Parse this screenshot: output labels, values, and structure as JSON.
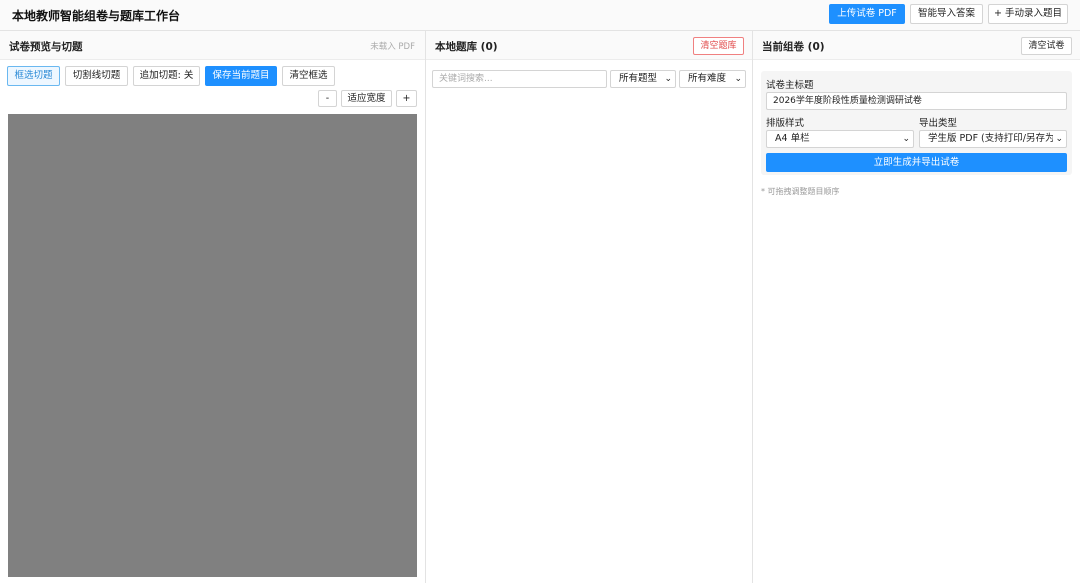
{
  "app": {
    "title": "本地教师智能组卷与题库工作台"
  },
  "header": {
    "upload_pdf": "上传试卷 PDF",
    "smart_import": "智能导入答案",
    "manual_add": "+ 手动录入题目"
  },
  "preview": {
    "title": "试卷预览与切题",
    "status": "未载入 PDF",
    "tools": {
      "box_select": "框选切题",
      "cut_line": "切割线切题",
      "append_toggle": "追加切题: 关",
      "save_question": "保存当前题目",
      "clear_selection": "清空框选"
    },
    "zoom": {
      "zoom_out": "-",
      "fit_width": "适应宽度",
      "zoom_in": "+"
    }
  },
  "bank": {
    "title": "本地题库 (0)",
    "clear": "清空题库",
    "search_placeholder": "关键词搜索...",
    "type_filter": "所有题型",
    "difficulty_filter": "所有难度"
  },
  "paper": {
    "title": "当前组卷 (0)",
    "clear": "清空试卷",
    "main_title_label": "试卷主标题",
    "main_title_value": "2026学年度阶段性质量检测调研试卷",
    "layout_label": "排版样式",
    "layout_value": "A4 单栏",
    "export_label": "导出类型",
    "export_value": "学生版 PDF (支持打印/另存为",
    "generate": "立即生成并导出试卷",
    "hint": "* 可拖拽调整题目顺序"
  },
  "colors": {
    "primary": "#1e90ff",
    "danger": "#e04848",
    "preview_bg": "#808080"
  }
}
